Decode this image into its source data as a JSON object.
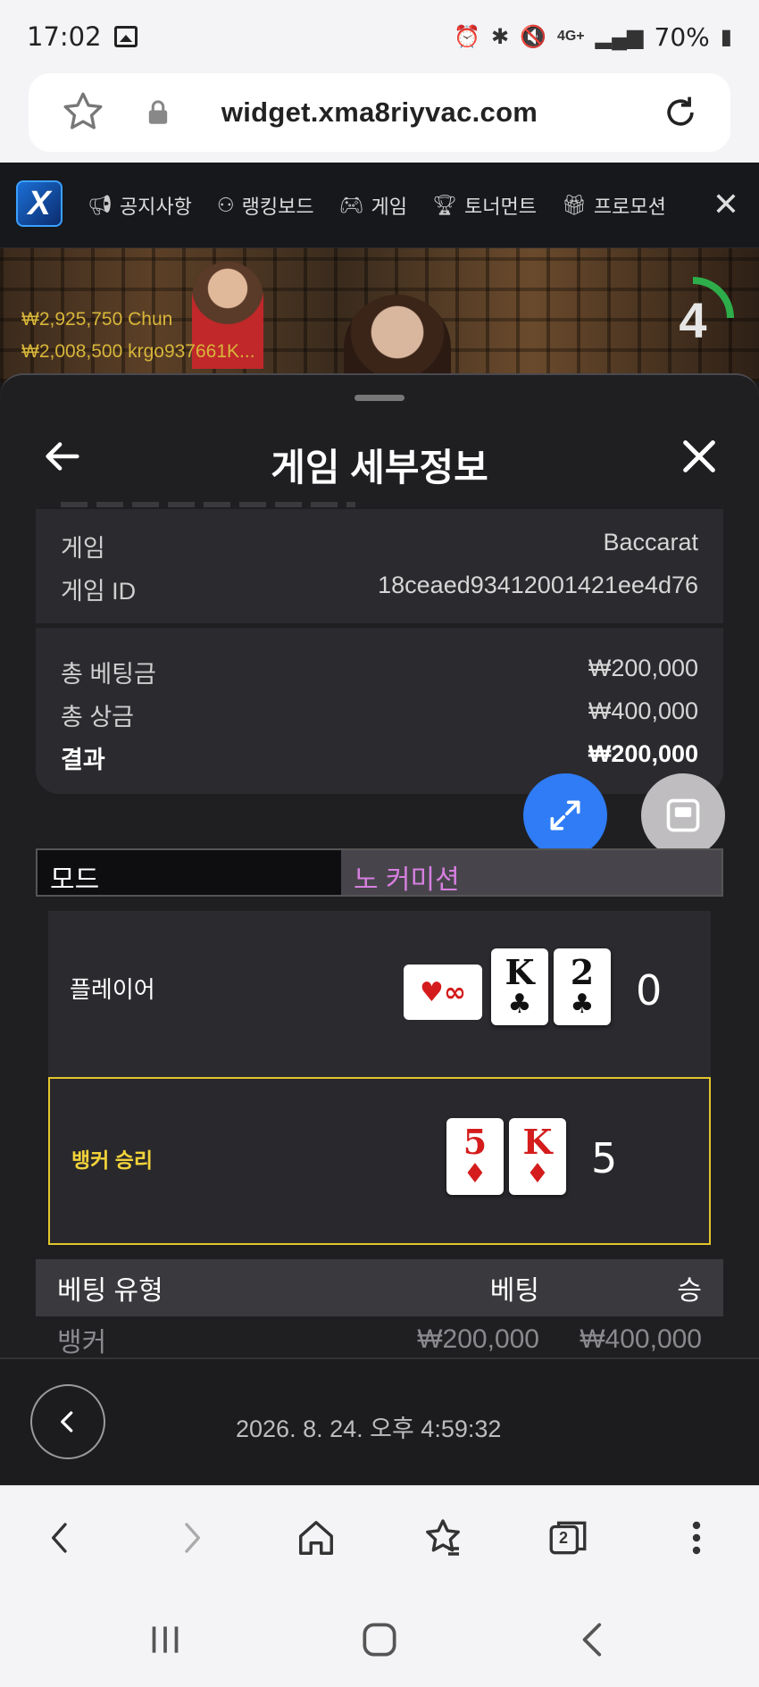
{
  "status_bar": {
    "time": "17:02",
    "network": "4G+",
    "battery": "70%"
  },
  "browser": {
    "url": "widget.xma8riyvac.com",
    "tab_count": "2"
  },
  "site_nav": {
    "logo_text": "X",
    "items": [
      {
        "label": "공지사항",
        "icon": "megaphone-icon"
      },
      {
        "label": "랭킹보드",
        "icon": "users-icon"
      },
      {
        "label": "게임",
        "icon": "gamepad-icon"
      },
      {
        "label": "토너먼트",
        "icon": "trophy-icon"
      },
      {
        "label": "프로모션",
        "icon": "gift-icon"
      }
    ]
  },
  "live_video": {
    "winners": [
      {
        "amount": "₩2,925,750",
        "name": "Chun"
      },
      {
        "amount": "₩2,008,500",
        "name": "krgo937661K..."
      }
    ],
    "countdown": "4"
  },
  "sheet": {
    "title": "게임 세부정보",
    "info_rows": [
      {
        "label": "게임",
        "value": "Baccarat"
      },
      {
        "label": "게임 ID",
        "value": "18ceaed93412001421ee4d76"
      }
    ],
    "summary_rows": [
      {
        "label": "총 베팅금",
        "value": "₩200,000"
      },
      {
        "label": "총 상금",
        "value": "₩400,000"
      },
      {
        "label": "결과",
        "value": "₩200,000"
      }
    ],
    "mode": {
      "label": "모드",
      "value": "노 커미션"
    },
    "player": {
      "label": "플레이어",
      "promo_card": "♥∞",
      "cards": [
        {
          "rank": "K",
          "suit": "♣",
          "color": "black"
        },
        {
          "rank": "2",
          "suit": "♣",
          "color": "black"
        }
      ],
      "score": "0"
    },
    "banker": {
      "label": "뱅커 승리",
      "cards": [
        {
          "rank": "5",
          "suit": "♦",
          "color": "red"
        },
        {
          "rank": "K",
          "suit": "♦",
          "color": "red"
        }
      ],
      "score": "5"
    },
    "bets": {
      "headers": [
        "베팅 유형",
        "베팅",
        "승"
      ],
      "rows": [
        {
          "type": "뱅커",
          "bet": "₩200,000",
          "win": "₩400,000"
        }
      ]
    },
    "timestamp": "2026. 8. 24. 오후 4:59:32"
  },
  "colors": {
    "accent_blue": "#2f7cf6",
    "banker_yellow": "#e2c62c",
    "mode_purple": "#d77fe0",
    "winner_gold": "#d8b63a"
  }
}
